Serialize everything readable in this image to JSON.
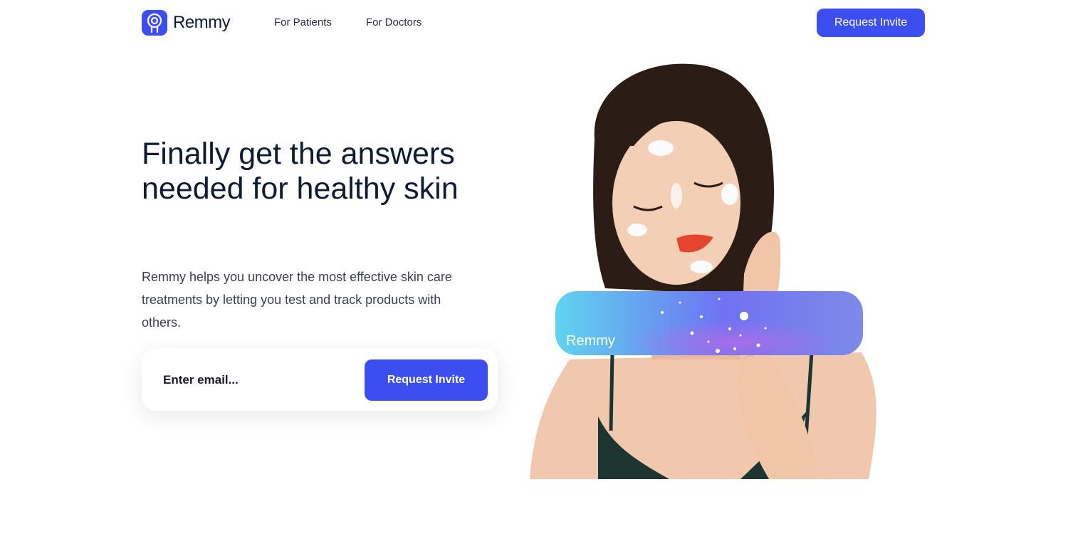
{
  "brand": {
    "name": "Remmy",
    "logo_icon": "remmy-logo-icon",
    "accent_color": "#3d4ef0"
  },
  "nav": {
    "links": [
      {
        "label": "For Patients"
      },
      {
        "label": "For Doctors"
      }
    ],
    "cta_label": "Request Invite"
  },
  "hero": {
    "headline_line1": "Finally get the answers",
    "headline_line2": "needed for healthy skin",
    "subtext": "Remmy helps you uncover the most effective skin care treatments by letting you test and track products with others.",
    "email_placeholder": "Enter email...",
    "cta_label": "Request Invite"
  },
  "image": {
    "card_label": "Remmy",
    "card_colors": [
      "#5fd4ef",
      "#6f72f2",
      "#9a6de8"
    ]
  }
}
